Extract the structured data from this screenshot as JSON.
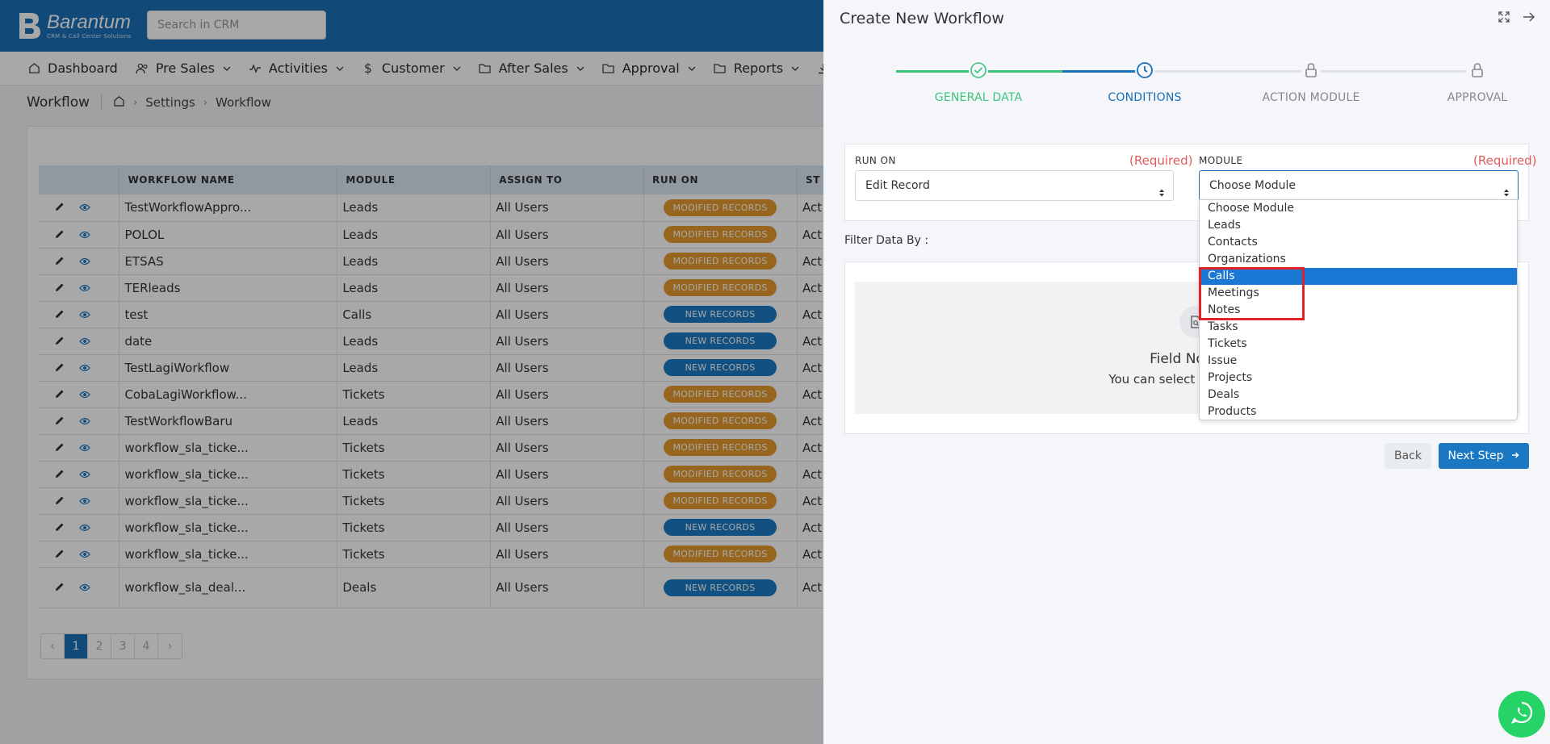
{
  "app": {
    "logo_name": "Barantum",
    "logo_sub": "CRM & Call Center Solutions",
    "search_placeholder": "Search in CRM"
  },
  "nav": [
    {
      "label": "Dashboard",
      "icon": "home-icon"
    },
    {
      "label": "Pre Sales",
      "icon": "users-icon"
    },
    {
      "label": "Activities",
      "icon": "activity-icon"
    },
    {
      "label": "Customer",
      "icon": "dollar-icon"
    },
    {
      "label": "After Sales",
      "icon": "folder-icon"
    },
    {
      "label": "Approval",
      "icon": "folder-icon"
    },
    {
      "label": "Reports",
      "icon": "folder-icon"
    }
  ],
  "breadcrumb": {
    "title": "Workflow",
    "items": [
      "Settings",
      "Workflow"
    ]
  },
  "table": {
    "columns": [
      "WORKFLOW NAME",
      "MODULE",
      "ASSIGN TO",
      "RUN ON",
      "ST"
    ],
    "rows": [
      {
        "name": "TestWorkflowAppro...",
        "module": "Leads",
        "assign": "All Users",
        "run_on": "MODIFIED RECORDS",
        "status": "Act"
      },
      {
        "name": "POLOL",
        "module": "Leads",
        "assign": "All Users",
        "run_on": "MODIFIED RECORDS",
        "status": "Act"
      },
      {
        "name": "ETSAS",
        "module": "Leads",
        "assign": "All Users",
        "run_on": "MODIFIED RECORDS",
        "status": "Act"
      },
      {
        "name": "TERleads",
        "module": "Leads",
        "assign": "All Users",
        "run_on": "MODIFIED RECORDS",
        "status": "Act"
      },
      {
        "name": "test",
        "module": "Calls",
        "assign": "All Users",
        "run_on": "NEW RECORDS",
        "status": "Act"
      },
      {
        "name": "date",
        "module": "Leads",
        "assign": "All Users",
        "run_on": "NEW RECORDS",
        "status": "Act"
      },
      {
        "name": "TestLagiWorkflow",
        "module": "Leads",
        "assign": "All Users",
        "run_on": "NEW RECORDS",
        "status": "Act"
      },
      {
        "name": "CobaLagiWorkflow...",
        "module": "Tickets",
        "assign": "All Users",
        "run_on": "MODIFIED RECORDS",
        "status": "Act"
      },
      {
        "name": "TestWorkflowBaru",
        "module": "Leads",
        "assign": "All Users",
        "run_on": "MODIFIED RECORDS",
        "status": "Act"
      },
      {
        "name": "workflow_sla_ticke...",
        "module": "Tickets",
        "assign": "All Users",
        "run_on": "MODIFIED RECORDS",
        "status": "Act"
      },
      {
        "name": "workflow_sla_ticke...",
        "module": "Tickets",
        "assign": "All Users",
        "run_on": "MODIFIED RECORDS",
        "status": "Act"
      },
      {
        "name": "workflow_sla_ticke...",
        "module": "Tickets",
        "assign": "All Users",
        "run_on": "MODIFIED RECORDS",
        "status": "Act"
      },
      {
        "name": "workflow_sla_ticke...",
        "module": "Tickets",
        "assign": "All Users",
        "run_on": "NEW RECORDS",
        "status": "Act"
      },
      {
        "name": "workflow_sla_ticke...",
        "module": "Tickets",
        "assign": "All Users",
        "run_on": "MODIFIED RECORDS",
        "status": "Act"
      },
      {
        "name": "workflow_sla_deal...",
        "module": "Deals",
        "assign": "All Users",
        "run_on": "NEW RECORDS",
        "status": "Act"
      }
    ]
  },
  "pager": {
    "prev": "‹",
    "pages": [
      "1",
      "2",
      "3",
      "4"
    ],
    "next": "›",
    "current": "1"
  },
  "panel": {
    "title": "Create New Workflow",
    "steps": [
      {
        "label": "GENERAL DATA",
        "state": "done"
      },
      {
        "label": "CONDITIONS",
        "state": "current"
      },
      {
        "label": "ACTION MODULE",
        "state": "locked"
      },
      {
        "label": "APPROVAL",
        "state": "locked"
      }
    ],
    "run_on_label": "RUN ON",
    "run_on_required": "(Required)",
    "run_on_value": "Edit Record",
    "module_label": "MODULE",
    "module_required": "(Required)",
    "module_value": "Choose Module",
    "filter_label": "Filter Data By :",
    "empty_title": "Field No Av",
    "empty_sub": "You can select active mod",
    "module_options": [
      "Choose Module",
      "Leads",
      "Contacts",
      "Organizations",
      "Calls",
      "Meetings",
      "Notes",
      "Tasks",
      "Tickets",
      "Issue",
      "Projects",
      "Deals",
      "Products"
    ],
    "module_selected_option": "Calls",
    "back_label": "Back",
    "next_label": "Next Step"
  },
  "colors": {
    "primary": "#1a70b8",
    "done": "#3cc47c",
    "modified": "#e59a2e",
    "new": "#1b7ac2",
    "required": "#e05a5a",
    "highlight": "#e0222a",
    "whatsapp": "#25d366"
  }
}
